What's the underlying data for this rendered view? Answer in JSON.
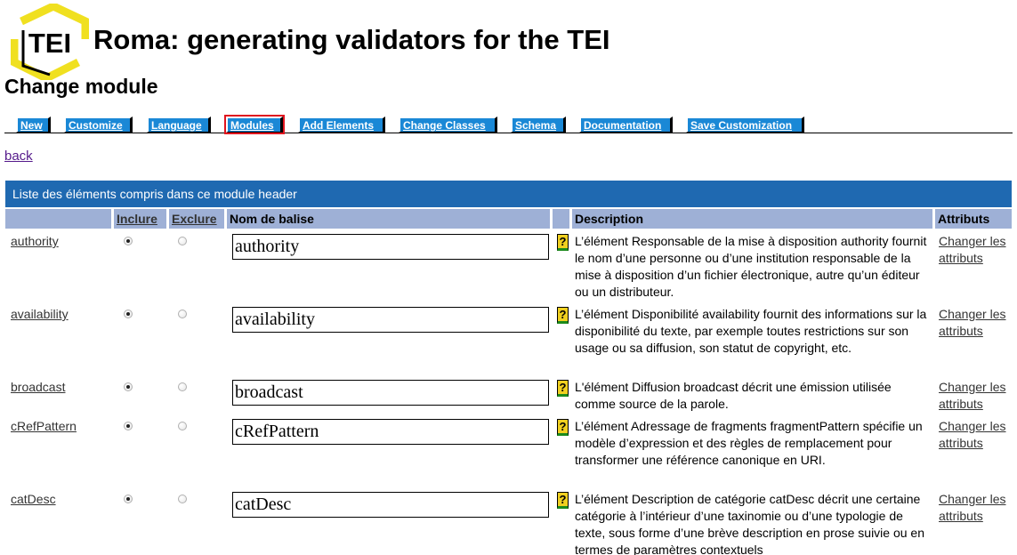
{
  "header": {
    "logo_text": "TEI",
    "app_title": "Roma: generating validators for the TEI",
    "page_heading": "Change module"
  },
  "nav": {
    "tabs": [
      {
        "label": "New",
        "active": false
      },
      {
        "label": "Customize",
        "active": false
      },
      {
        "label": "Language",
        "active": false
      },
      {
        "label": "Modules",
        "active": true
      },
      {
        "label": "Add Elements",
        "active": false
      },
      {
        "label": "Change Classes",
        "active": false
      },
      {
        "label": "Schema",
        "active": false
      },
      {
        "label": "Documentation",
        "active": false
      },
      {
        "label": "Save Customization",
        "active": false
      }
    ]
  },
  "back_label": "back",
  "table": {
    "caption": "Liste des éléments compris dans ce module header",
    "columns": {
      "include": "Inclure",
      "exclude": "Exclure",
      "name": "Nom de balise",
      "help": "",
      "description": "Description",
      "attributes": "Attributs"
    },
    "rows": [
      {
        "element": "authority",
        "included": true,
        "name_value": "authority",
        "help": "?",
        "description": "L’élément Responsable de la mise à disposition authority fournit le nom d’une personne ou d’une institution responsable de la mise à disposition d’un fichier électronique, autre qu’un éditeur ou un distributeur.",
        "attr_link": "Changer les attributs"
      },
      {
        "element": "availability",
        "included": true,
        "name_value": "availability",
        "help": "?",
        "description": "L’élément Disponibilité availability fournit des informations sur la disponibilité du texte, par exemple toutes restrictions sur son usage ou sa diffusion, son statut de copyright, etc.",
        "attr_link": "Changer les attributs"
      },
      {
        "element": "broadcast",
        "included": true,
        "name_value": "broadcast",
        "help": "?",
        "description": "L'élément Diffusion broadcast décrit une émission utilisée comme source de la parole.",
        "attr_link": "Changer les attributs"
      },
      {
        "element": "cRefPattern",
        "included": true,
        "name_value": "cRefPattern",
        "help": "?",
        "description": "L’élément Adressage de fragments fragmentPattern spécifie un modèle d’expression et des règles de remplacement pour transformer une référence canonique en URI.",
        "attr_link": "Changer les attributs"
      },
      {
        "element": "catDesc",
        "included": true,
        "name_value": "catDesc",
        "help": "?",
        "description": "L’élément Description de catégorie catDesc décrit une certaine catégorie à l’intérieur d’une taxinomie ou d’une typologie de texte, sous forme d’une brève description en prose suivie ou en termes de paramètres contextuels",
        "attr_link": "Changer les attributs"
      }
    ]
  },
  "colors": {
    "tab_bg": "#1a88d6",
    "active_outline": "#e0141e",
    "caption_bg": "#1f69b1",
    "header_bg": "#9eb0d6",
    "logo_yellow": "#f0e020",
    "help_yellow": "#f0d020",
    "help_green": "#1c8a1c"
  }
}
